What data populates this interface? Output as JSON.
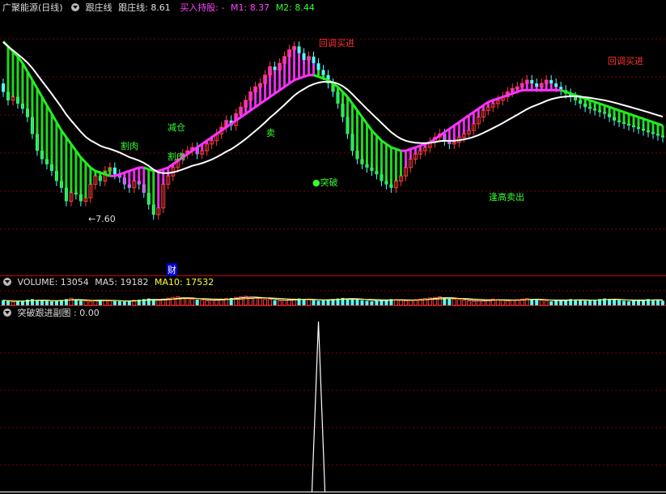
{
  "header": {
    "stock_name": "广聚能源(日线)",
    "indicator_name": "跟庄线",
    "indicator_label": "跟庄线:",
    "indicator_value": "8.61",
    "buy_label": "买入持股: -",
    "m1_label": "M1:",
    "m1_value": "8.37",
    "m2_label": "M2:",
    "m2_value": "8.44"
  },
  "volume_header": {
    "label": "VOLUME:",
    "value": "13054",
    "ma5_label": "MA5:",
    "ma5_value": "19182",
    "ma10_label": "MA10:",
    "ma10_value": "17532"
  },
  "sub_header": {
    "label": "突破跟进副图",
    "value": ": 0.00"
  },
  "annotations": {
    "callback_buy_1": "回调买进",
    "callback_buy_2": "回调买进",
    "cut_1": "割肉",
    "cut_2": "割肉",
    "reduce": "减仓",
    "sell": "卖",
    "breakout": "●突破",
    "high_sell": "逢高卖出",
    "low_price": "←7.60",
    "finance": "财"
  },
  "colors": {
    "up": "#ff3c3c",
    "down": "#54ffff",
    "green_band": "#22ee22",
    "magenta_line": "#ff33ff",
    "white_line": "#ffffff",
    "grid": "#7a0000",
    "frame": "#cc0000",
    "ma5": "#ffffff",
    "ma10": "#ffff33"
  },
  "chart_data": [
    {
      "type": "candlestick",
      "title": "广聚能源(日线)",
      "ylim": [
        7.6,
        8.9
      ],
      "low_marker": 7.6,
      "x": [
        0,
        1,
        2,
        3,
        4,
        5,
        6,
        7,
        8,
        9,
        10,
        11,
        12,
        13,
        14,
        15,
        16,
        17,
        18,
        19,
        20,
        21,
        22,
        23,
        24,
        25,
        26,
        27,
        28,
        29,
        30,
        31,
        32,
        33,
        34,
        35,
        36,
        37,
        38,
        39,
        40,
        41,
        42,
        43,
        44,
        45,
        46,
        47,
        48,
        49,
        50,
        51,
        52,
        53,
        54,
        55,
        56,
        57,
        58,
        59,
        60,
        61,
        62,
        63,
        64,
        65,
        66,
        67,
        68,
        69,
        70,
        71,
        72,
        73,
        74,
        75,
        76,
        77,
        78,
        79,
        80,
        81,
        82,
        83,
        84,
        85,
        86,
        87,
        88,
        89,
        90,
        91,
        92,
        93,
        94,
        95,
        96,
        97,
        98,
        99,
        100,
        101,
        102,
        103,
        104,
        105,
        106,
        107,
        108,
        109,
        110,
        111,
        112,
        113,
        114,
        115,
        116,
        117,
        118,
        119,
        120,
        121,
        122,
        123,
        124,
        125,
        126,
        127,
        128,
        129,
        130,
        131,
        132,
        133,
        134,
        135,
        136
      ],
      "open": [
        8.5,
        8.45,
        8.4,
        8.42,
        8.38,
        8.35,
        8.3,
        8.2,
        8.1,
        8.05,
        8.02,
        7.98,
        7.92,
        7.88,
        7.8,
        7.85,
        7.84,
        7.8,
        7.82,
        7.9,
        7.95,
        7.92,
        7.98,
        8.0,
        7.96,
        7.94,
        7.9,
        7.88,
        7.92,
        7.9,
        7.85,
        7.78,
        7.72,
        7.76,
        7.9,
        7.95,
        8.0,
        8.05,
        8.08,
        8.1,
        8.12,
        8.08,
        8.1,
        8.14,
        8.16,
        8.2,
        8.24,
        8.28,
        8.25,
        8.32,
        8.36,
        8.4,
        8.45,
        8.48,
        8.5,
        8.55,
        8.6,
        8.58,
        8.62,
        8.66,
        8.7,
        8.72,
        8.68,
        8.64,
        8.66,
        8.62,
        8.58,
        8.55,
        8.5,
        8.45,
        8.38,
        8.3,
        8.2,
        8.1,
        8.05,
        8.02,
        8.0,
        7.98,
        7.96,
        7.92,
        7.9,
        7.88,
        7.92,
        7.95,
        8.0,
        8.05,
        8.08,
        8.1,
        8.12,
        8.15,
        8.18,
        8.2,
        8.16,
        8.14,
        8.15,
        8.18,
        8.2,
        8.22,
        8.26,
        8.3,
        8.34,
        8.36,
        8.38,
        8.4,
        8.42,
        8.45,
        8.47,
        8.48,
        8.5,
        8.52,
        8.5,
        8.48,
        8.5,
        8.52,
        8.5,
        8.48,
        8.46,
        8.44,
        8.42,
        8.4,
        8.38,
        8.36,
        8.35,
        8.34,
        8.33,
        8.32,
        8.3,
        8.28,
        8.27,
        8.26,
        8.25,
        8.24,
        8.23,
        8.22,
        8.21,
        8.2,
        8.19
      ],
      "close": [
        8.45,
        8.4,
        8.42,
        8.38,
        8.35,
        8.3,
        8.2,
        8.1,
        8.05,
        8.02,
        7.98,
        7.92,
        7.88,
        7.8,
        7.85,
        7.84,
        7.8,
        7.82,
        7.9,
        7.95,
        7.92,
        7.98,
        8.0,
        7.96,
        7.94,
        7.9,
        7.88,
        7.92,
        7.9,
        7.85,
        7.78,
        7.72,
        7.76,
        7.9,
        7.95,
        8.0,
        8.05,
        8.08,
        8.1,
        8.12,
        8.08,
        8.1,
        8.14,
        8.16,
        8.2,
        8.24,
        8.28,
        8.25,
        8.32,
        8.36,
        8.4,
        8.45,
        8.48,
        8.5,
        8.55,
        8.6,
        8.58,
        8.62,
        8.66,
        8.7,
        8.72,
        8.68,
        8.64,
        8.66,
        8.62,
        8.58,
        8.55,
        8.5,
        8.45,
        8.38,
        8.3,
        8.2,
        8.1,
        8.05,
        8.02,
        8.0,
        7.98,
        7.96,
        7.92,
        7.9,
        7.88,
        7.92,
        7.95,
        8.0,
        8.05,
        8.08,
        8.1,
        8.12,
        8.15,
        8.18,
        8.2,
        8.16,
        8.14,
        8.15,
        8.18,
        8.2,
        8.22,
        8.26,
        8.3,
        8.34,
        8.36,
        8.38,
        8.4,
        8.42,
        8.45,
        8.47,
        8.48,
        8.5,
        8.52,
        8.5,
        8.48,
        8.5,
        8.52,
        8.5,
        8.48,
        8.46,
        8.44,
        8.42,
        8.4,
        8.38,
        8.36,
        8.35,
        8.34,
        8.33,
        8.32,
        8.3,
        8.28,
        8.27,
        8.26,
        8.25,
        8.24,
        8.23,
        8.22,
        8.21,
        8.2,
        8.19,
        8.18
      ]
    },
    {
      "type": "line",
      "name": "跟庄线",
      "y": [
        8.75,
        8.72,
        8.69,
        8.66,
        8.62,
        8.57,
        8.52,
        8.47,
        8.42,
        8.37,
        8.32,
        8.27,
        8.22,
        8.18,
        8.14,
        8.1,
        8.06,
        8.03,
        8.0,
        7.98,
        7.97,
        7.96,
        7.95,
        7.95,
        7.96,
        7.97,
        7.98,
        7.99,
        8.0,
        8.0,
        7.99,
        7.98,
        7.98,
        7.99,
        8.0,
        8.02,
        8.04,
        8.06,
        8.08,
        8.1,
        8.12,
        8.14,
        8.16,
        8.18,
        8.2,
        8.22,
        8.24,
        8.26,
        8.28,
        8.3,
        8.32,
        8.34,
        8.36,
        8.38,
        8.4,
        8.42,
        8.44,
        8.46,
        8.48,
        8.5,
        8.52,
        8.53,
        8.54,
        8.55,
        8.55,
        8.54,
        8.53,
        8.52,
        8.5,
        8.48,
        8.45,
        8.42,
        8.38,
        8.34,
        8.3,
        8.26,
        8.22,
        8.19,
        8.16,
        8.14,
        8.12,
        8.11,
        8.1,
        8.1,
        8.11,
        8.12,
        8.13,
        8.14,
        8.15,
        8.17,
        8.19,
        8.21,
        8.23,
        8.25,
        8.27,
        8.29,
        8.31,
        8.33,
        8.35,
        8.37,
        8.39,
        8.4,
        8.41,
        8.42,
        8.43,
        8.44,
        8.45,
        8.46,
        8.46,
        8.46,
        8.46,
        8.46,
        8.46,
        8.46,
        8.46,
        8.46,
        8.45,
        8.44,
        8.43,
        8.42,
        8.41,
        8.4,
        8.39,
        8.38,
        8.37,
        8.36,
        8.35,
        8.34,
        8.33,
        8.32,
        8.31,
        8.3,
        8.29,
        8.28,
        8.27,
        8.26,
        8.25
      ]
    },
    {
      "type": "bar",
      "name": "VOLUME",
      "values": [
        18,
        15,
        12,
        14,
        16,
        20,
        22,
        18,
        16,
        15,
        14,
        17,
        19,
        22,
        25,
        18,
        16,
        15,
        14,
        17,
        20,
        18,
        16,
        15,
        14,
        13,
        16,
        18,
        20,
        22,
        24,
        20,
        18,
        22,
        25,
        28,
        30,
        26,
        24,
        22,
        20,
        18,
        16,
        18,
        20,
        22,
        24,
        26,
        28,
        30,
        32,
        28,
        26,
        24,
        22,
        20,
        18,
        16,
        18,
        20,
        22,
        24,
        22,
        20,
        18,
        16,
        18,
        20,
        22,
        24,
        26,
        24,
        22,
        20,
        18,
        16,
        14,
        16,
        18,
        20,
        22,
        20,
        18,
        16,
        18,
        20,
        22,
        24,
        26,
        28,
        30,
        26,
        24,
        22,
        20,
        18,
        16,
        14,
        16,
        18,
        20,
        22,
        20,
        18,
        16,
        18,
        20,
        22,
        24,
        22,
        20,
        18,
        16,
        14,
        16,
        18,
        20,
        22,
        20,
        18,
        16,
        18,
        20,
        22,
        24,
        22,
        20,
        18,
        16,
        14,
        16,
        18,
        20,
        22,
        20,
        18,
        16
      ]
    },
    {
      "type": "line",
      "name": "突破跟进副图",
      "peak_index": 65,
      "peak_value": 1,
      "ylim": [
        0,
        1
      ]
    }
  ]
}
